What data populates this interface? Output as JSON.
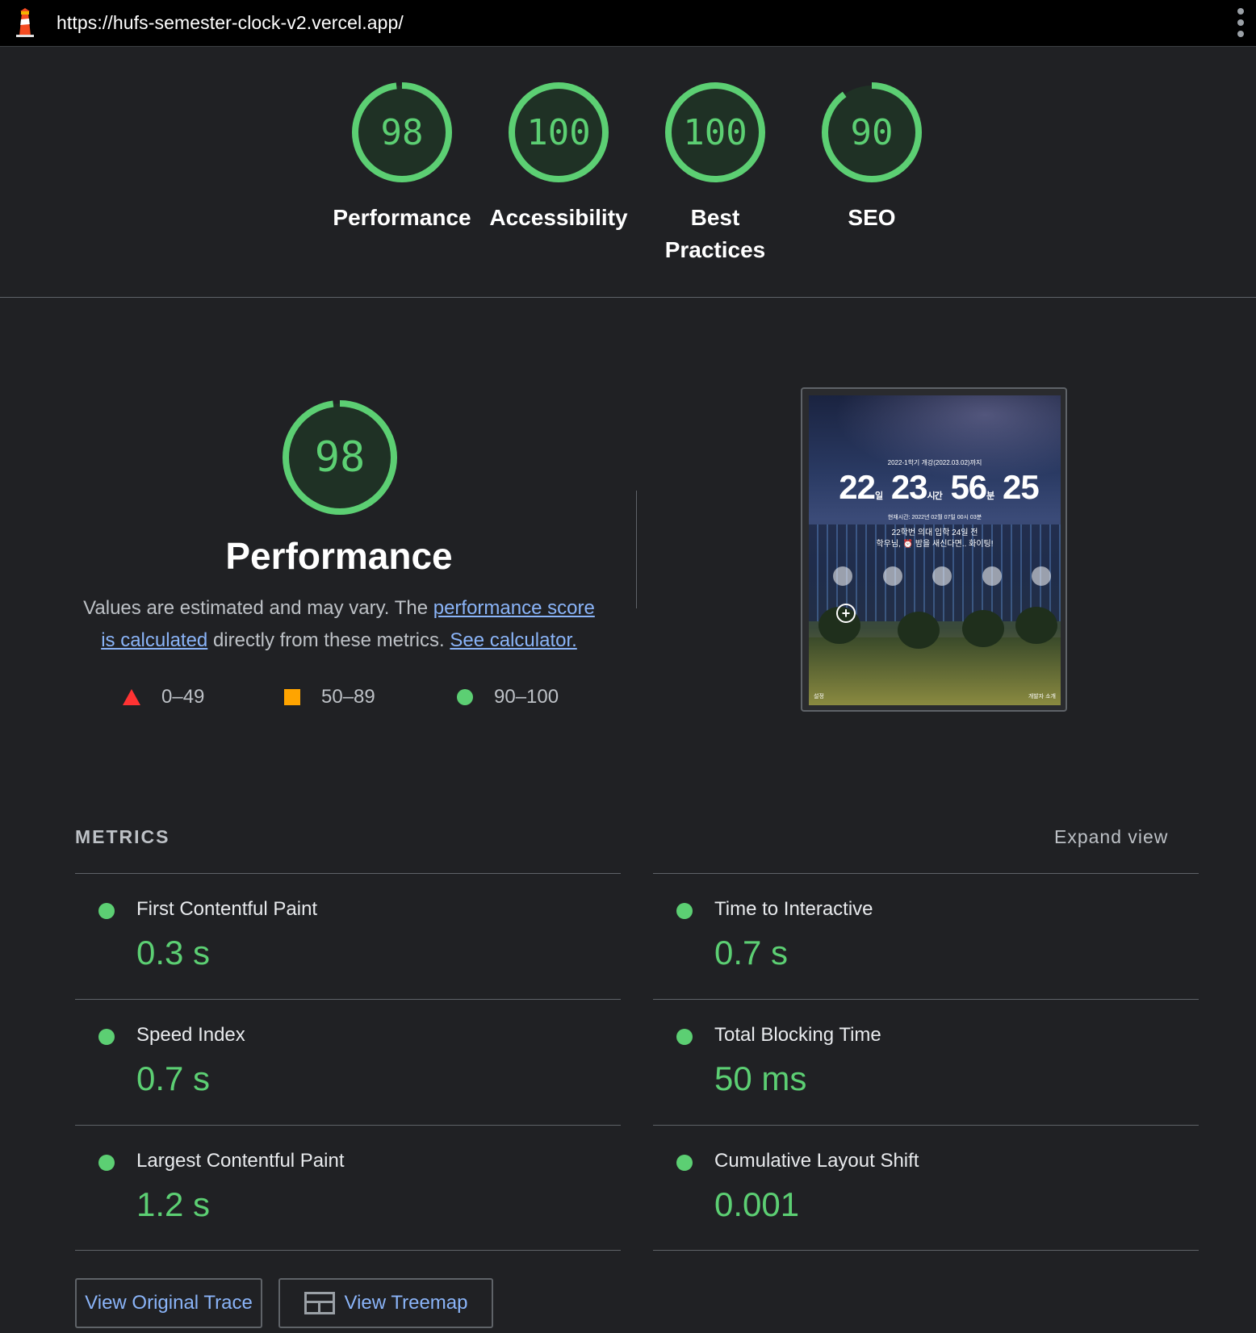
{
  "url": "https://hufs-semester-clock-v2.vercel.app/",
  "colors": {
    "pass": "#5ccf73",
    "average": "#ffa400",
    "fail": "#ff3333",
    "link": "#8ab4f8"
  },
  "categories": [
    {
      "score": "98",
      "label": "Performance",
      "fraction": 0.98
    },
    {
      "score": "100",
      "label": "Accessibility",
      "fraction": 1.0
    },
    {
      "score": "100",
      "label": "Best Practices",
      "fraction": 1.0
    },
    {
      "score": "90",
      "label": "SEO",
      "fraction": 0.9
    }
  ],
  "performance": {
    "score": "98",
    "fraction": 0.98,
    "title": "Performance",
    "desc_prefix": "Values are estimated and may vary. The ",
    "link_score": "performance score is calculated",
    "desc_middle": " directly from these metrics. ",
    "link_calculator": "See calculator.",
    "legend": {
      "fail": "0–49",
      "average": "50–89",
      "pass": "90–100"
    }
  },
  "screenshot": {
    "top_text": "2022-1학기 개강(2022.03.02)까지",
    "days": "22",
    "days_unit": "일",
    "hours": "23",
    "hours_unit": "시간",
    "minutes": "56",
    "minutes_unit": "분",
    "seconds": "25",
    "now_text": "현재시간: 2022년 02월 07일 00시 03분",
    "msg_line1": "22학번 의대 입학 24일 전",
    "msg_line2": "학우님, ⏰ 밤을 새신다면.. 화이팅!",
    "footer_left": "설정",
    "footer_right": "개발자 소개"
  },
  "metrics": {
    "heading": "METRICS",
    "expand": "Expand view",
    "left": [
      {
        "name": "First Contentful Paint",
        "value": "0.3 s"
      },
      {
        "name": "Speed Index",
        "value": "0.7 s"
      },
      {
        "name": "Largest Contentful Paint",
        "value": "1.2 s"
      }
    ],
    "right": [
      {
        "name": "Time to Interactive",
        "value": "0.7 s"
      },
      {
        "name": "Total Blocking Time",
        "value": "50 ms"
      },
      {
        "name": "Cumulative Layout Shift",
        "value": "0.001"
      }
    ]
  },
  "buttons": {
    "trace": "View Original Trace",
    "treemap": "View Treemap"
  }
}
